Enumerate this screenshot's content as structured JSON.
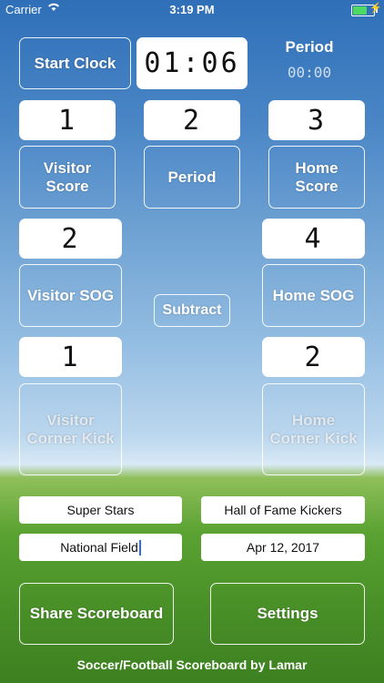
{
  "status_bar": {
    "carrier": "Carrier",
    "time": "3:19 PM"
  },
  "clock": {
    "start_label": "Start Clock",
    "time": "01:06"
  },
  "period": {
    "title": "Period",
    "display": "00:00"
  },
  "score_row": {
    "visitor_value": "1",
    "period_value": "2",
    "home_value": "3",
    "visitor_label": "Visitor\nScore",
    "period_label": "Period",
    "home_label": "Home\nScore"
  },
  "sog": {
    "visitor_value": "2",
    "home_value": "4",
    "visitor_label": "Visitor SOG",
    "home_label": "Home SOG",
    "subtract_label": "Subtract"
  },
  "corner": {
    "visitor_value": "1",
    "home_value": "2",
    "visitor_label": "Visitor\nCorner Kick",
    "home_label": "Home\nCorner Kick"
  },
  "fields": {
    "visitor_team": "Super Stars",
    "home_team": "Hall of Fame Kickers",
    "location": "National Field",
    "date": "Apr 12, 2017"
  },
  "actions": {
    "share_label": "Share Scoreboard",
    "settings_label": "Settings"
  },
  "footer": "Soccer/Football Scoreboard by Lamar"
}
